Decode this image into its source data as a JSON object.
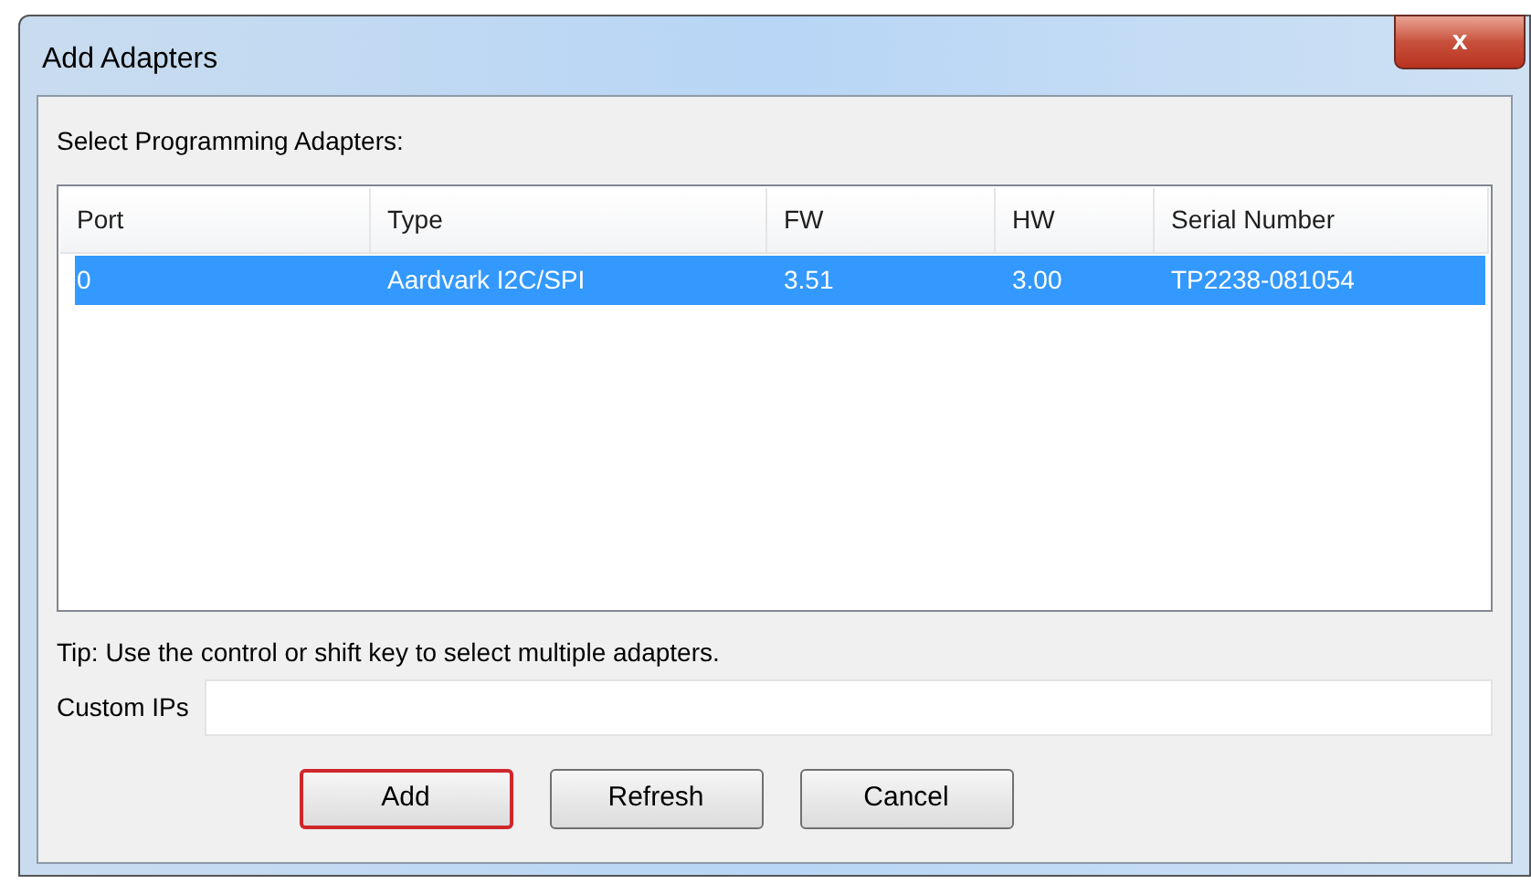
{
  "window": {
    "title": "Add Adapters",
    "close_button": "x"
  },
  "prompt": "Select Programming Adapters:",
  "table": {
    "columns": [
      "Port",
      "Type",
      "FW",
      "HW",
      "Serial Number"
    ],
    "rows": [
      {
        "cells": [
          "0",
          "Aardvark I2C/SPI",
          "3.51",
          "3.00",
          "TP2238-081054"
        ],
        "selected": true
      }
    ]
  },
  "tip": "Tip: Use the control or shift key to select multiple adapters.",
  "custom_ips": {
    "label": "Custom IPs"
  },
  "buttons": [
    {
      "label": "Add",
      "highlighted": true
    },
    {
      "label": "Refresh",
      "highlighted": false
    },
    {
      "label": "Cancel",
      "highlighted": false
    }
  ]
}
